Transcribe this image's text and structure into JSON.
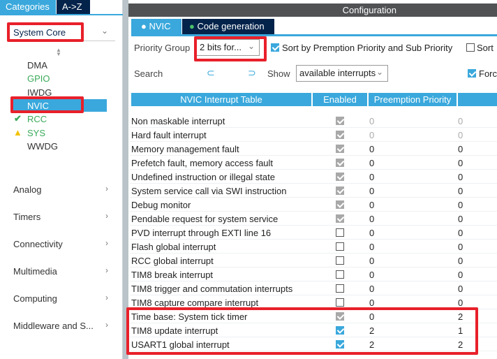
{
  "sidebar": {
    "tabs": [
      "Categories",
      "A->Z"
    ],
    "category": "System Core",
    "peripherals": [
      {
        "label": "DMA",
        "color": "#333333"
      },
      {
        "label": "GPIO",
        "color": "#3aaa5a"
      },
      {
        "label": "IWDG",
        "color": "#333333"
      },
      {
        "label": "NVIC",
        "color": "#ffffff"
      },
      {
        "label": "RCC",
        "color": "#3aaa5a",
        "icon": "check-icon"
      },
      {
        "label": "SYS",
        "color": "#3aaa5a",
        "icon": "warning-icon"
      },
      {
        "label": "WWDG",
        "color": "#333333"
      }
    ],
    "categories": [
      "Analog",
      "Timers",
      "Connectivity",
      "Multimedia",
      "Computing",
      "Middleware and S..."
    ]
  },
  "config": {
    "title": "Configuration",
    "tabs": [
      "NVIC",
      "Code generation"
    ],
    "priority_group_label": "Priority Group",
    "priority_group_value": "2 bits for...",
    "sort_label": "Sort by Premption Priority and Sub Priority",
    "sort2_label": "Sort",
    "search_label": "Search",
    "show_label": "Show",
    "show_value": "available interrupts",
    "force_label": "Forc"
  },
  "table": {
    "headers": [
      "NVIC Interrupt Table",
      "Enabled",
      "Preemption Priority",
      ""
    ],
    "rows": [
      {
        "name": "Non maskable interrupt",
        "enabled": "locked",
        "pre": "0",
        "sub": "0",
        "muted": true
      },
      {
        "name": "Hard fault interrupt",
        "enabled": "locked",
        "pre": "0",
        "sub": "0",
        "muted": true
      },
      {
        "name": "Memory management fault",
        "enabled": "locked",
        "pre": "0",
        "sub": "0"
      },
      {
        "name": "Prefetch fault, memory access fault",
        "enabled": "locked",
        "pre": "0",
        "sub": "0"
      },
      {
        "name": "Undefined instruction or illegal state",
        "enabled": "locked",
        "pre": "0",
        "sub": "0"
      },
      {
        "name": "System service call via SWI instruction",
        "enabled": "locked",
        "pre": "0",
        "sub": "0"
      },
      {
        "name": "Debug monitor",
        "enabled": "locked",
        "pre": "0",
        "sub": "0"
      },
      {
        "name": "Pendable request for system service",
        "enabled": "locked",
        "pre": "0",
        "sub": "0"
      },
      {
        "name": "PVD interrupt through EXTI line 16",
        "enabled": "off",
        "pre": "0",
        "sub": "0"
      },
      {
        "name": "Flash global interrupt",
        "enabled": "off",
        "pre": "0",
        "sub": "0"
      },
      {
        "name": "RCC global interrupt",
        "enabled": "off",
        "pre": "0",
        "sub": "0"
      },
      {
        "name": "TIM8 break interrupt",
        "enabled": "off",
        "pre": "0",
        "sub": "0"
      },
      {
        "name": "TIM8 trigger and commutation interrupts",
        "enabled": "off",
        "pre": "0",
        "sub": "0"
      },
      {
        "name": "TIM8 capture compare interrupt",
        "enabled": "off",
        "pre": "0",
        "sub": "0"
      },
      {
        "name": "Time base: System tick timer",
        "enabled": "locked",
        "pre": "0",
        "sub": "2"
      },
      {
        "name": "TIM8 update interrupt",
        "enabled": "on",
        "pre": "2",
        "sub": "1"
      },
      {
        "name": "USART1 global interrupt",
        "enabled": "on",
        "pre": "2",
        "sub": "2"
      }
    ]
  }
}
